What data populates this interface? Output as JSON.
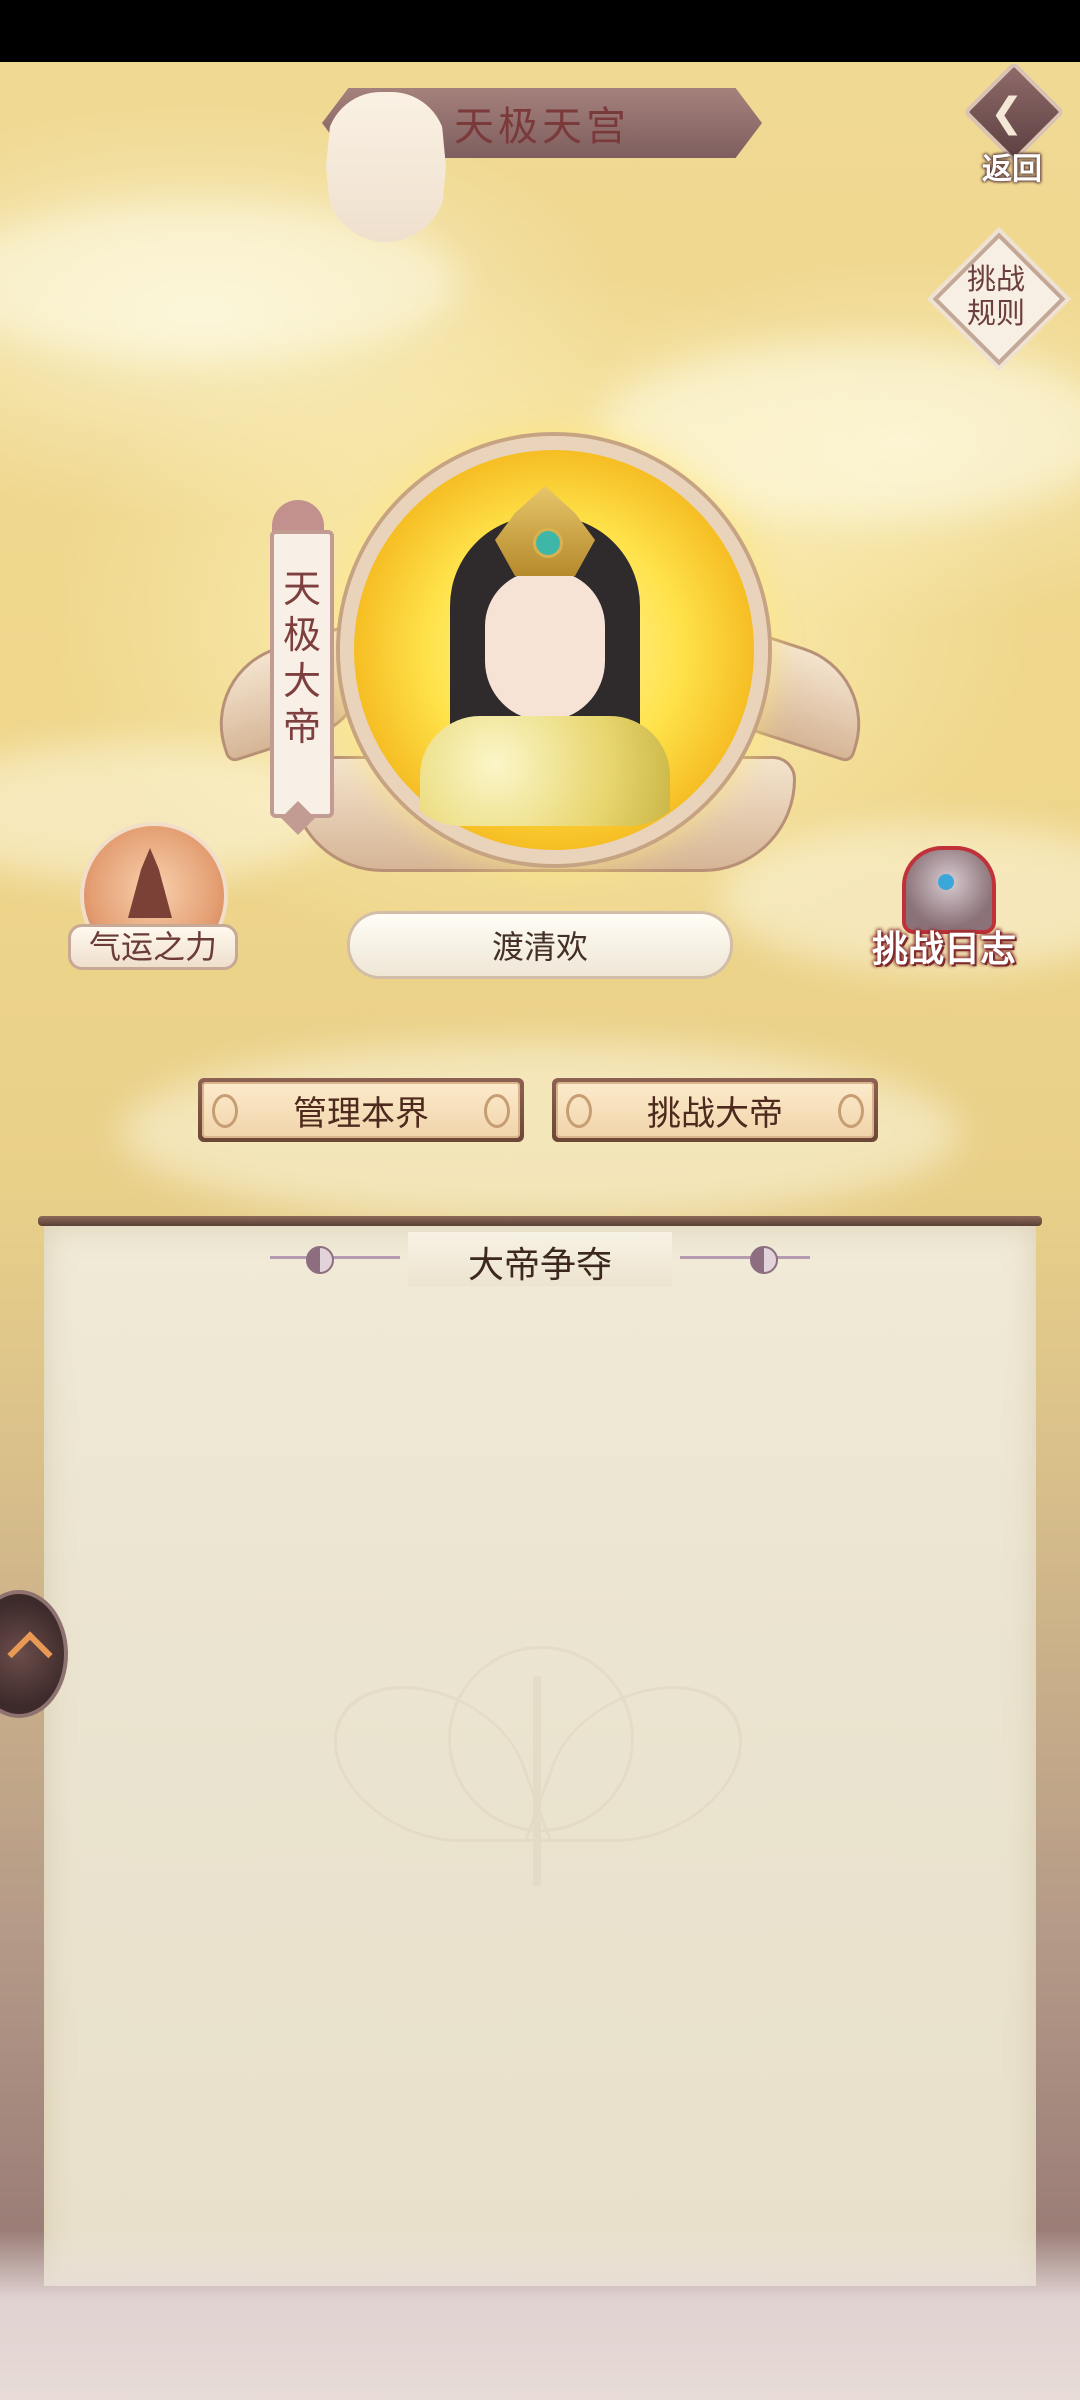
{
  "header": {
    "title": "天极天宫",
    "back_label": "返回"
  },
  "side_buttons": {
    "rules_label": "挑战\n规则",
    "luck_label": "气运之力",
    "log_label": "挑战日志"
  },
  "emperor": {
    "rank_title": "天极大帝",
    "player_name": "渡清欢"
  },
  "actions": {
    "manage_label": "管理本界",
    "challenge_label": "挑战大帝"
  },
  "panel": {
    "title": "大帝争夺"
  },
  "colors": {
    "accent_text": "#7a3a3a",
    "gold_glow": "#ffe24a",
    "panel_paper": "#ebe4d0"
  }
}
